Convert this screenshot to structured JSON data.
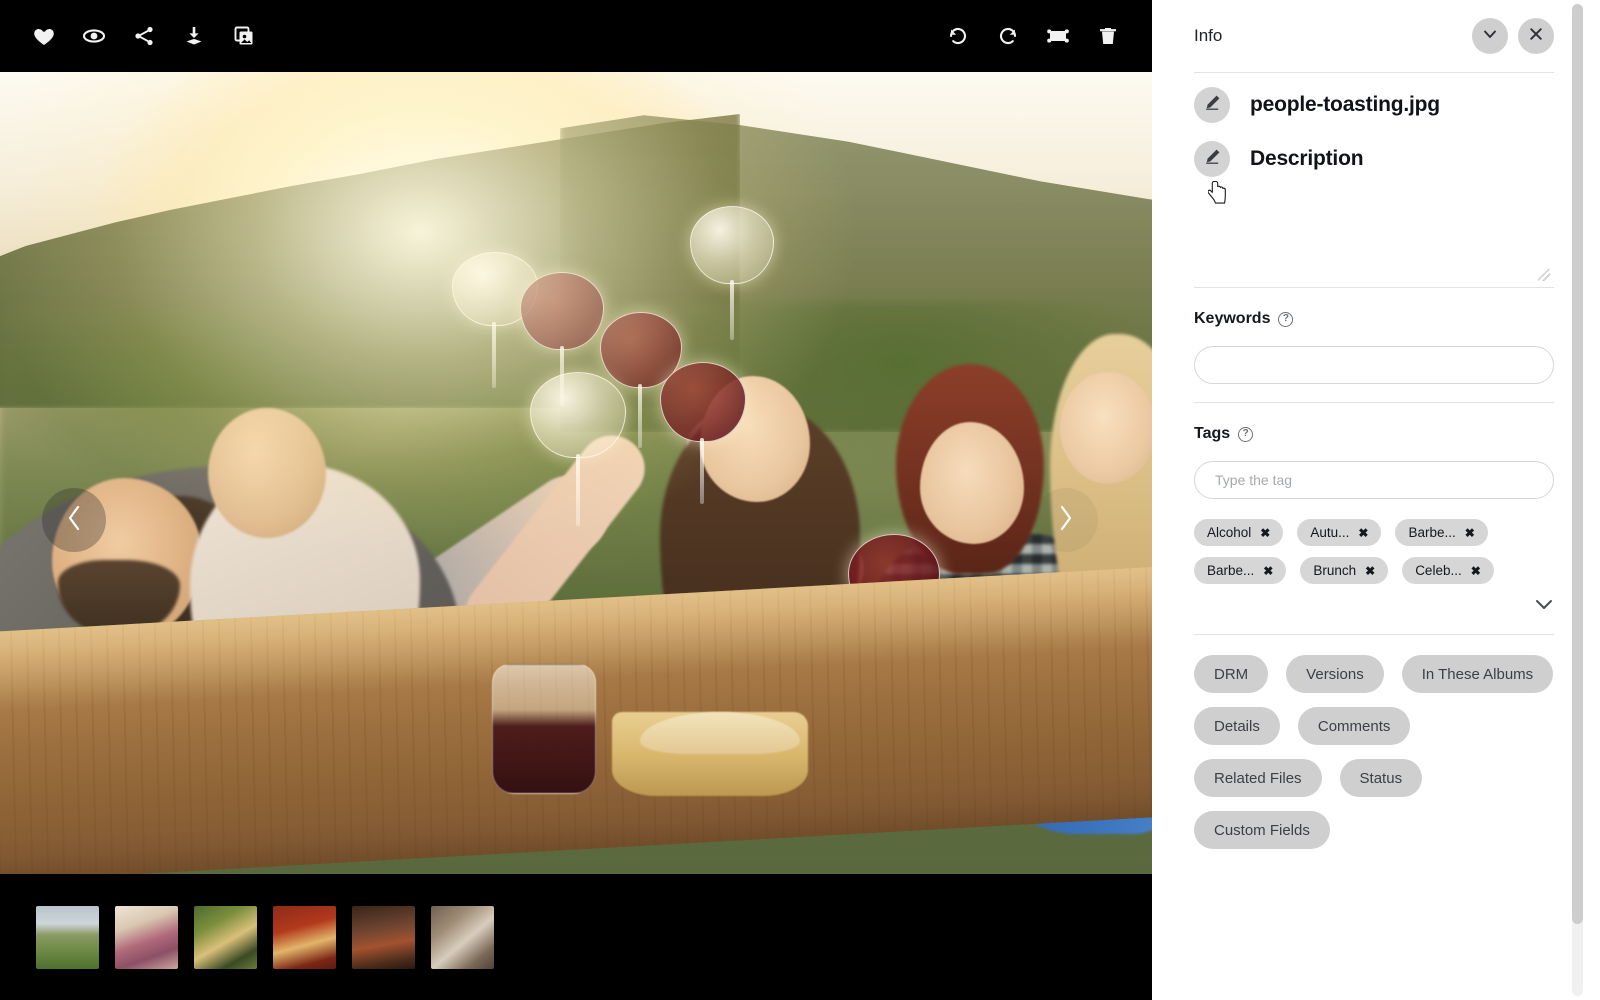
{
  "viewer": {
    "toolbar": {
      "left_actions": [
        {
          "name": "favorite",
          "icon": "heart-icon",
          "label": "Favorite"
        },
        {
          "name": "preview",
          "icon": "eye-icon",
          "label": "Preview"
        },
        {
          "name": "share",
          "icon": "share-icon",
          "label": "Share"
        },
        {
          "name": "download",
          "icon": "download-icon",
          "label": "Download"
        },
        {
          "name": "duplicate",
          "icon": "image-copy-icon",
          "label": "Duplicate"
        }
      ],
      "right_actions": [
        {
          "name": "rotate-left",
          "icon": "rotate-left-icon",
          "label": "Rotate Left"
        },
        {
          "name": "rotate-right",
          "icon": "rotate-right-icon",
          "label": "Rotate Right"
        },
        {
          "name": "fit-screen",
          "icon": "fit-screen-icon",
          "label": "Fit to Screen"
        },
        {
          "name": "delete",
          "icon": "trash-icon",
          "label": "Delete"
        }
      ]
    },
    "navigation": {
      "prev_label": "Previous image",
      "next_label": "Next image"
    },
    "filmstrip": [
      {
        "name": "thumb-vineyard",
        "label": "Vineyard landscape"
      },
      {
        "name": "thumb-toasting",
        "label": "People toasting"
      },
      {
        "name": "thumb-picnic",
        "label": "Picnic table"
      },
      {
        "name": "thumb-beer-wine",
        "label": "Beer and wine"
      },
      {
        "name": "thumb-barrel",
        "label": "Wine barrel"
      },
      {
        "name": "thumb-cheers",
        "label": "Cheers close-up"
      }
    ]
  },
  "panel": {
    "title": "Info",
    "header_actions": [
      {
        "name": "collapse",
        "icon": "chevron-down-icon",
        "label": "Collapse"
      },
      {
        "name": "close",
        "icon": "close-icon",
        "label": "Close"
      }
    ],
    "filename": {
      "value": "people-toasting.jpg",
      "edit_label": "Edit file name",
      "edit_icon": "pencil-icon"
    },
    "description": {
      "label": "Description",
      "value": "",
      "edit_label": "Edit description",
      "edit_icon": "pencil-icon",
      "resize_handle": "resize-grip"
    },
    "keywords": {
      "title": "Keywords",
      "help_glyph": "?",
      "value": "",
      "placeholder": ""
    },
    "tags": {
      "title": "Tags",
      "help_glyph": "?",
      "value": "",
      "placeholder": "Type the tag",
      "chips": [
        {
          "label": "Alcohol",
          "remove": "✖"
        },
        {
          "label": "Autu...",
          "remove": "✖"
        },
        {
          "label": "Barbe...",
          "remove": "✖"
        },
        {
          "label": "Barbe...",
          "remove": "✖"
        },
        {
          "label": "Brunch",
          "remove": "✖"
        },
        {
          "label": "Celeb...",
          "remove": "✖"
        }
      ],
      "expand_icon": "chevron-down-icon",
      "expand_label": "Show more tags"
    },
    "section_buttons": [
      {
        "label": "DRM"
      },
      {
        "label": "Versions"
      },
      {
        "label": "In These Albums"
      },
      {
        "label": "Details"
      },
      {
        "label": "Comments"
      },
      {
        "label": "Related Files"
      },
      {
        "label": "Status"
      },
      {
        "label": "Custom Fields"
      }
    ]
  },
  "colors": {
    "toolbar_bg": "#000000",
    "panel_bg": "#ffffff",
    "chip_bg": "#d6d6d6",
    "button_bg": "#cfcfcf",
    "text_primary": "#15181e",
    "divider": "#e2e2e2",
    "scrollbar_thumb": "#cdcdcd"
  }
}
